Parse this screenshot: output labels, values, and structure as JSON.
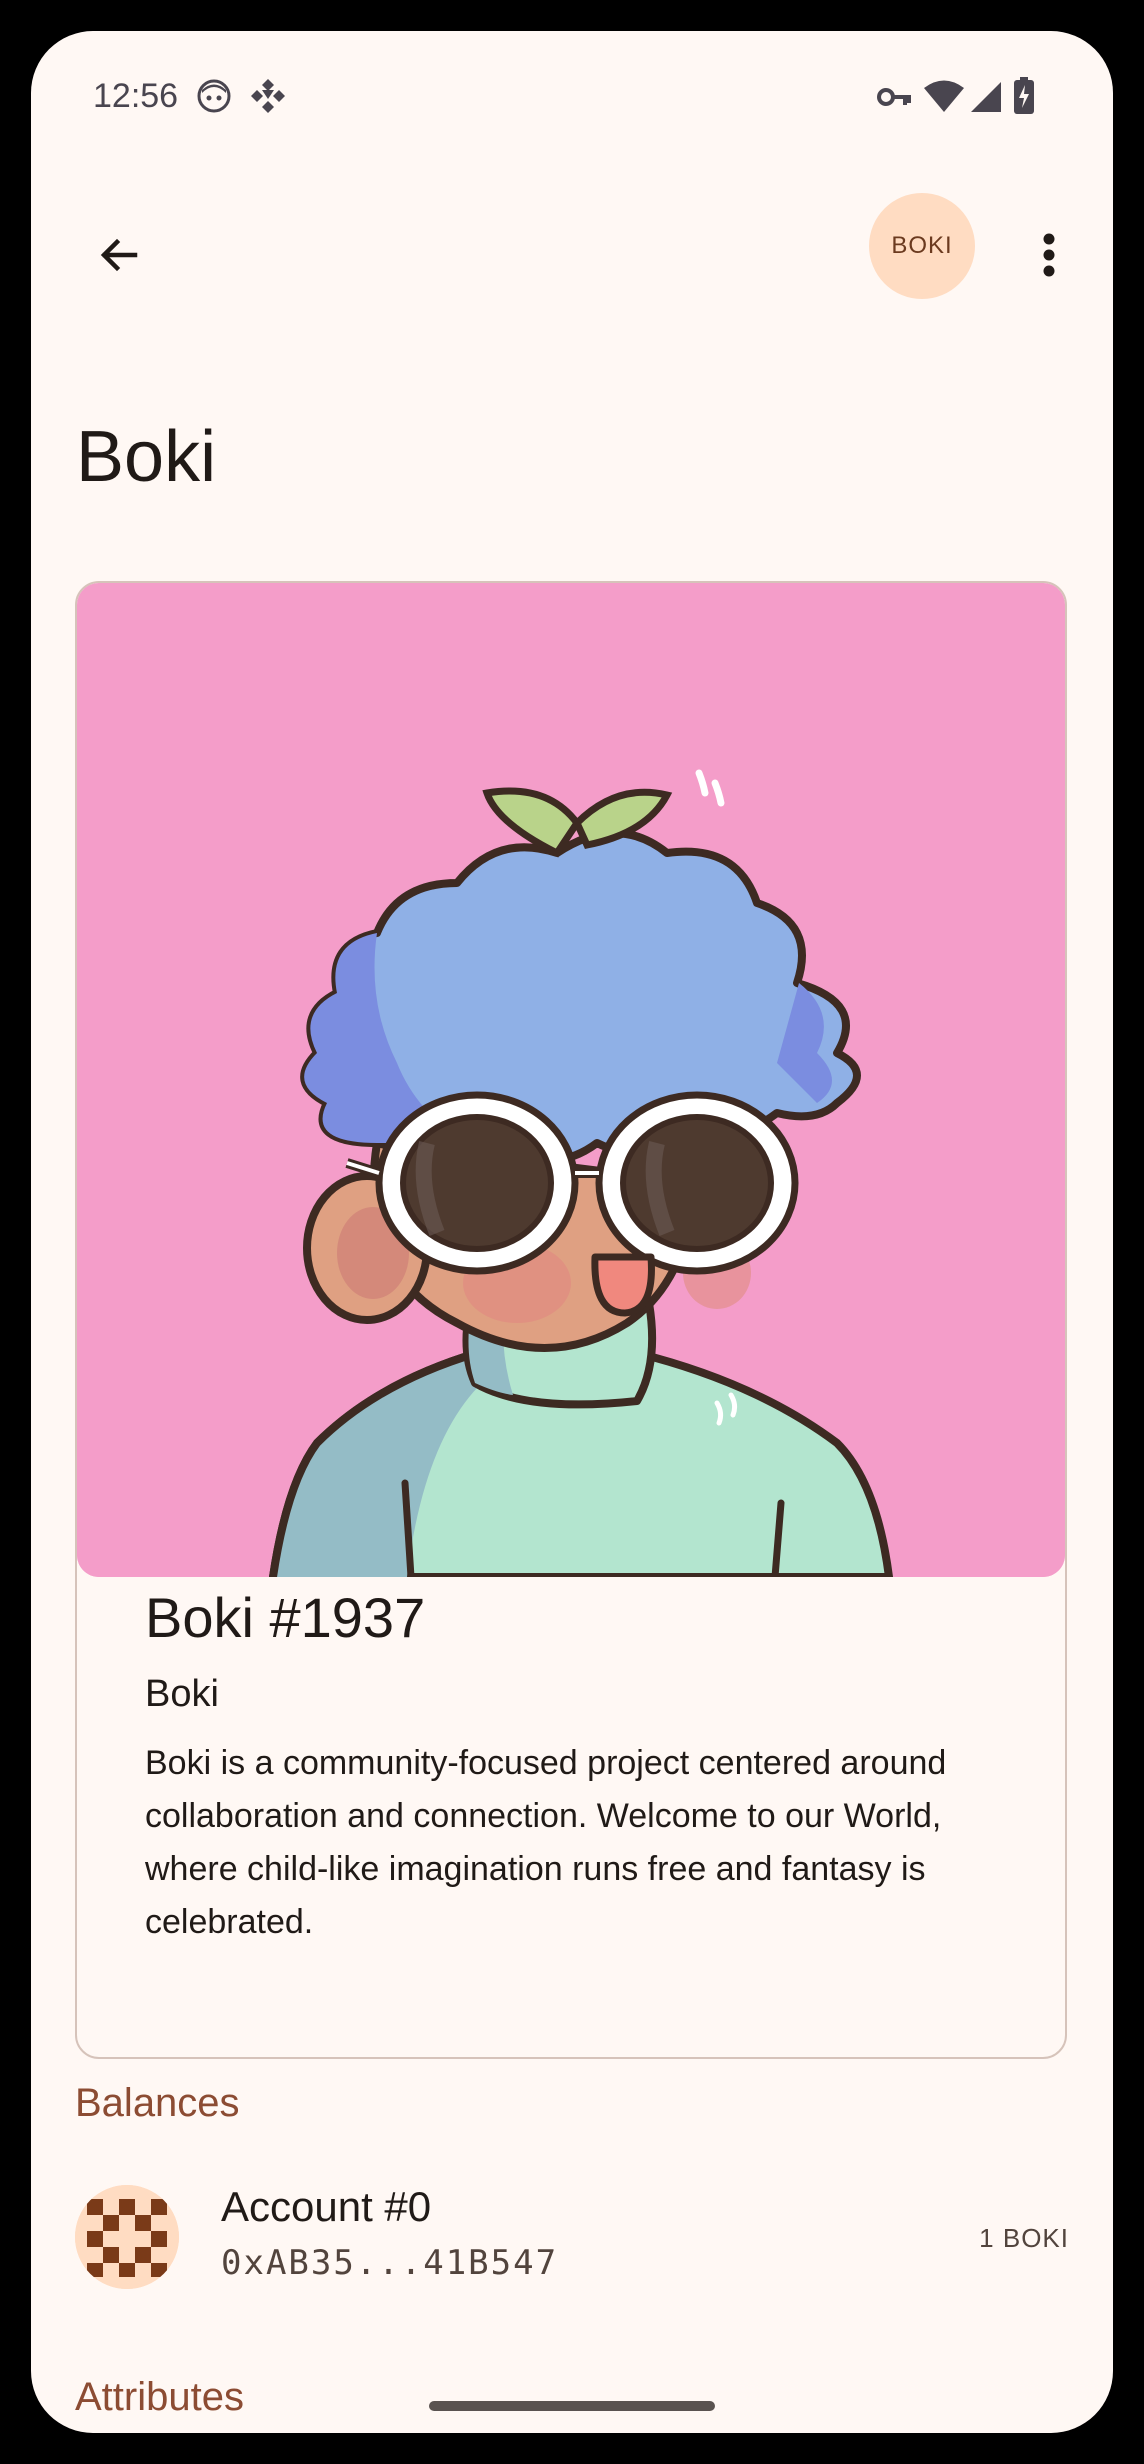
{
  "status_bar": {
    "time": "12:56"
  },
  "app_bar": {
    "token_symbol": "BOKI"
  },
  "page": {
    "title": "Boki"
  },
  "nft": {
    "name": "Boki #1937",
    "collection": "Boki",
    "description": "Boki is a community-focused project centered around collaboration and connection. Welcome to our World, where child-like imagination runs free and fantasy is celebrated.",
    "background_color": "#f49dc9"
  },
  "balances": {
    "section_title": "Balances",
    "items": [
      {
        "account_name": "Account #0",
        "address": "0xAB35...41B547",
        "amount": "1 BOKI"
      }
    ]
  },
  "attributes": {
    "section_title": "Attributes"
  },
  "colors": {
    "background": "#fff8f4",
    "accent": "#8c4c33",
    "chip": "#ffdcc2"
  }
}
